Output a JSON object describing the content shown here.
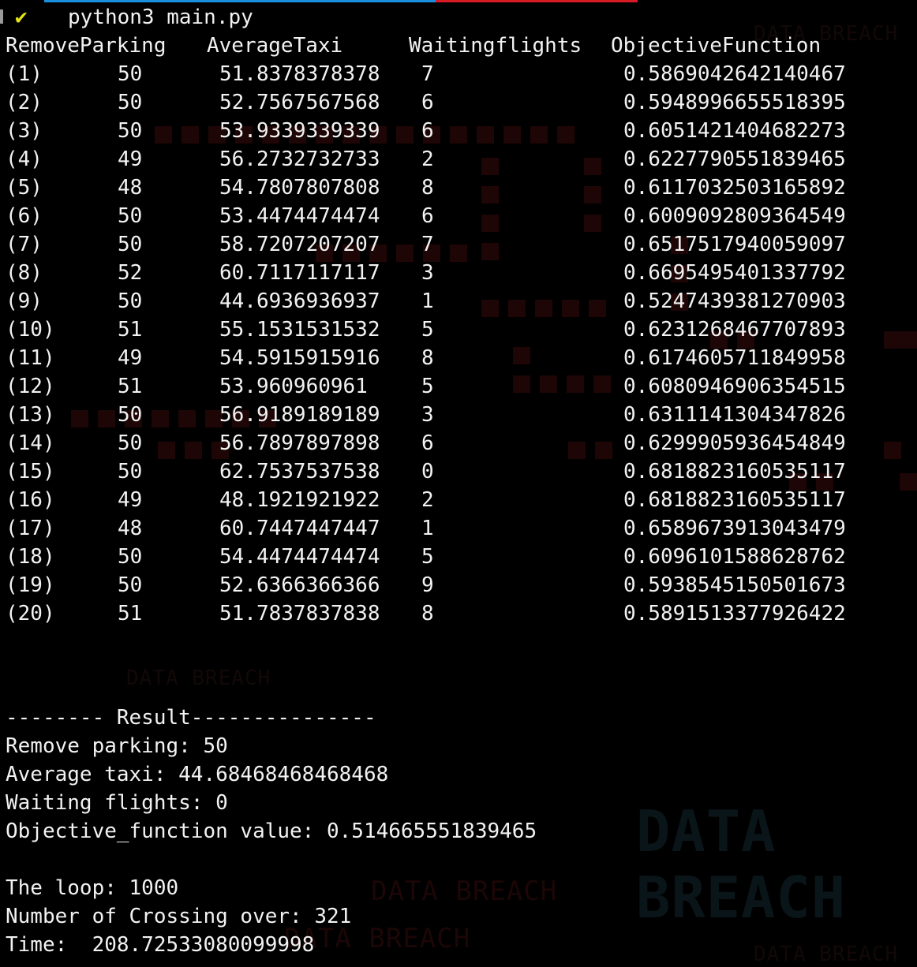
{
  "terminal": {
    "prompt_icon": "check-icon",
    "prompt_command": "python3 main.py",
    "accent_colors": {
      "tab_blue": "#1b8fe0",
      "tab_red": "#d81b25",
      "check": "#e5e514"
    }
  },
  "table": {
    "headers": [
      "RemoveParking",
      "AverageTaxi",
      "Waitingflights",
      "ObjectiveFunction"
    ],
    "rows": [
      {
        "idx": "(1)",
        "parking": "50",
        "taxi": "51.8378378378",
        "waiting": "7",
        "objective": "0.5869042642140467"
      },
      {
        "idx": "(2)",
        "parking": "50",
        "taxi": "52.7567567568",
        "waiting": "6",
        "objective": "0.5948996655518395"
      },
      {
        "idx": "(3)",
        "parking": "50",
        "taxi": "53.9339339339",
        "waiting": "6",
        "objective": "0.6051421404682273"
      },
      {
        "idx": "(4)",
        "parking": "49",
        "taxi": "56.2732732733",
        "waiting": "2",
        "objective": "0.6227790551839465"
      },
      {
        "idx": "(5)",
        "parking": "48",
        "taxi": "54.7807807808",
        "waiting": "8",
        "objective": "0.6117032503165892"
      },
      {
        "idx": "(6)",
        "parking": "50",
        "taxi": "53.4474474474",
        "waiting": "6",
        "objective": "0.6009092809364549"
      },
      {
        "idx": "(7)",
        "parking": "50",
        "taxi": "58.7207207207",
        "waiting": "7",
        "objective": "0.6517517940059097"
      },
      {
        "idx": "(8)",
        "parking": "52",
        "taxi": "60.7117117117",
        "waiting": "3",
        "objective": "0.6695495401337792"
      },
      {
        "idx": "(9)",
        "parking": "50",
        "taxi": "44.6936936937",
        "waiting": "1",
        "objective": "0.5247439381270903"
      },
      {
        "idx": "(10)",
        "parking": "51",
        "taxi": "55.1531531532",
        "waiting": "5",
        "objective": "0.6231268467707893"
      },
      {
        "idx": "(11)",
        "parking": "49",
        "taxi": "54.5915915916",
        "waiting": "8",
        "objective": "0.6174605711849958"
      },
      {
        "idx": "(12)",
        "parking": "51",
        "taxi": "53.960960961",
        "waiting": "5",
        "objective": "0.6080946906354515"
      },
      {
        "idx": "(13)",
        "parking": "50",
        "taxi": "56.9189189189",
        "waiting": "3",
        "objective": "0.6311141304347826"
      },
      {
        "idx": "(14)",
        "parking": "50",
        "taxi": "56.7897897898",
        "waiting": "6",
        "objective": "0.6299905936454849"
      },
      {
        "idx": "(15)",
        "parking": "50",
        "taxi": "62.7537537538",
        "waiting": "0",
        "objective": "0.6818823160535117"
      },
      {
        "idx": "(16)",
        "parking": "49",
        "taxi": "48.1921921922",
        "waiting": "2",
        "objective": "0.6818823160535117"
      },
      {
        "idx": "(17)",
        "parking": "48",
        "taxi": "60.7447447447",
        "waiting": "1",
        "objective": "0.6589673913043479"
      },
      {
        "idx": "(18)",
        "parking": "50",
        "taxi": "54.4474474474",
        "waiting": "5",
        "objective": "0.6096101588628762"
      },
      {
        "idx": "(19)",
        "parking": "50",
        "taxi": "52.6366366366",
        "waiting": "9",
        "objective": "0.5938545150501673"
      },
      {
        "idx": "(20)",
        "parking": "51",
        "taxi": "51.7837837838",
        "waiting": "8",
        "objective": "0.5891513377926422"
      }
    ]
  },
  "result": {
    "header": "-------- Result---------------",
    "remove_parking": "Remove parking: 50",
    "average_taxi": "Average taxi: 44.68468468468468",
    "waiting_flights": "Waiting flights: 0",
    "objective": "Objective_function value: 0.514665551839465",
    "loop": "The loop: 1000",
    "crossing": "Number of Crossing over: 321",
    "time": "Time:  208.72533080099998"
  },
  "background": {
    "watermark_text": "DATA BREACH"
  }
}
